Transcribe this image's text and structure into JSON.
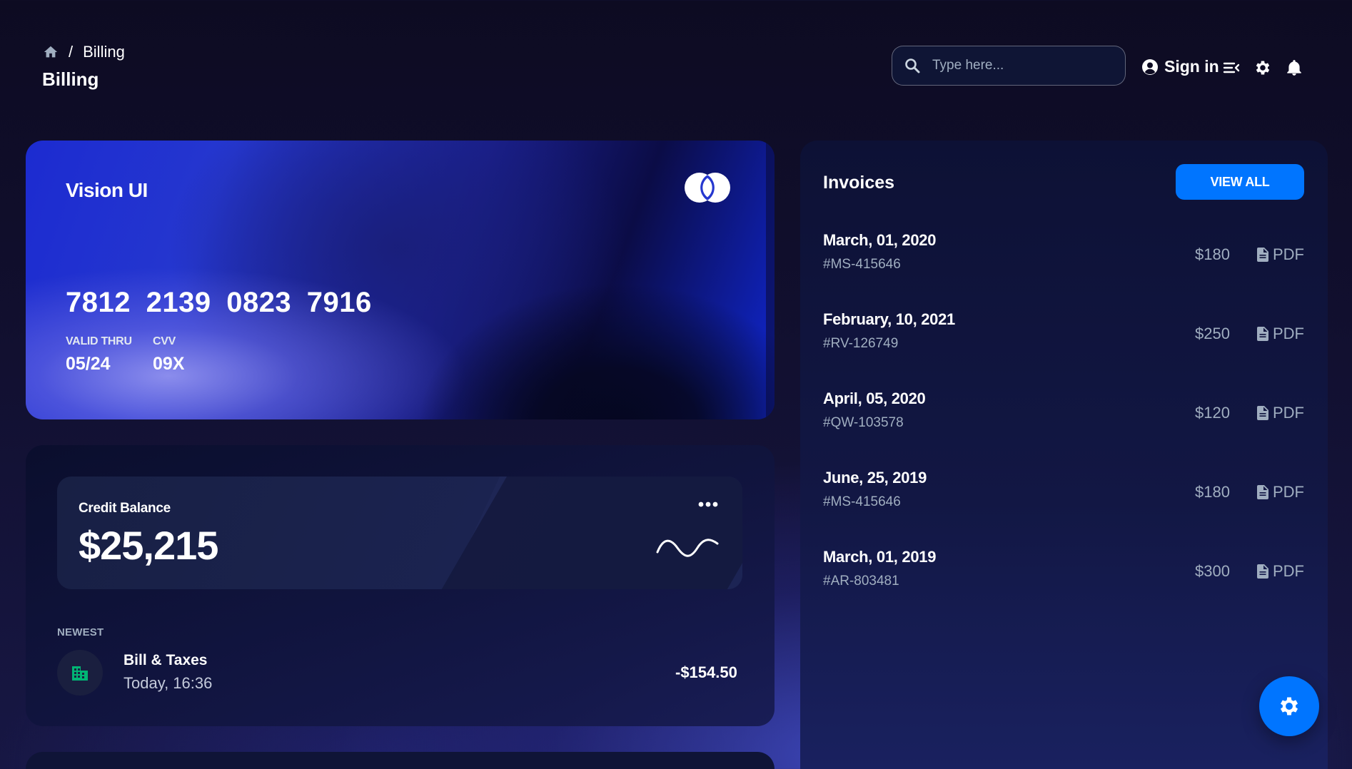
{
  "breadcrumb": {
    "home_icon": "home-icon",
    "separator": "/",
    "current": "Billing"
  },
  "page_title": "Billing",
  "header": {
    "search_placeholder": "Type here...",
    "search_icon": "search-icon",
    "signin_label": "Sign in",
    "icons": [
      "user-circle-icon",
      "menu-icon",
      "gear-icon",
      "bell-icon"
    ]
  },
  "card": {
    "brand": "Vision UI",
    "logo_icon": "mastercard-logo-icon",
    "number": "7812 2139 0823 7916",
    "valid_thru_label": "VALID THRU",
    "valid_thru": "05/24",
    "cvv_label": "CVV",
    "cvv": "09X"
  },
  "balance": {
    "label": "Credit Balance",
    "value": "$25,215",
    "more_icon": "more-horizontal-icon",
    "sparkline_icon": "wave-graph-icon"
  },
  "transactions": {
    "section_label": "NEWEST",
    "items": [
      {
        "icon": "building-icon",
        "title": "Bill & Taxes",
        "time": "Today, 16:36",
        "amount": "-$154.50"
      }
    ]
  },
  "invoices": {
    "title": "Invoices",
    "view_all_label": "VIEW ALL",
    "pdf_label": "PDF",
    "items": [
      {
        "date": "March, 01, 2020",
        "id": "#MS-415646",
        "price": "$180"
      },
      {
        "date": "February, 10, 2021",
        "id": "#RV-126749",
        "price": "$250"
      },
      {
        "date": "April, 05, 2020",
        "id": "#QW-103578",
        "price": "$120"
      },
      {
        "date": "June, 25, 2019",
        "id": "#MS-415646",
        "price": "$180"
      },
      {
        "date": "March, 01, 2019",
        "id": "#AR-803481",
        "price": "$300"
      }
    ]
  },
  "fab_icon": "settings-gear-icon",
  "colors": {
    "accent": "#0075ff",
    "muted_text": "#a0aec0",
    "transaction_icon": "#01b574"
  }
}
